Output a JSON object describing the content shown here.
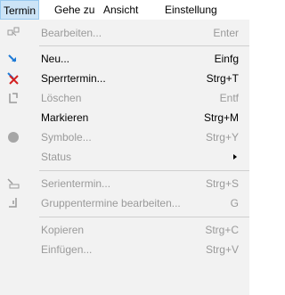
{
  "menubar": {
    "items": [
      {
        "label": "Termin",
        "active": true
      },
      {
        "label": "Gehe zu"
      },
      {
        "label": "Ansicht"
      },
      {
        "label": "Einstellung"
      }
    ]
  },
  "menu": {
    "items": [
      {
        "label": "Bearbeiten...",
        "shortcut": "Enter",
        "enabled": false,
        "icon": "edit-appointment-icon"
      },
      {
        "label": "Neu...",
        "shortcut": "Einfg",
        "enabled": true,
        "icon": "new-appointment-icon"
      },
      {
        "label": "Sperrtermin...",
        "shortcut": "Strg+T",
        "enabled": true,
        "icon": "block-appointment-icon"
      },
      {
        "label": "Löschen",
        "shortcut": "Entf",
        "enabled": false,
        "icon": "delete-icon"
      },
      {
        "label": "Markieren",
        "shortcut": "Strg+M",
        "enabled": true,
        "icon": ""
      },
      {
        "label": "Symbole...",
        "shortcut": "Strg+Y",
        "enabled": false,
        "icon": "symbol-circle-icon"
      },
      {
        "label": "Status",
        "shortcut": "",
        "enabled": false,
        "submenu": true,
        "icon": ""
      },
      {
        "label": "Serientermin...",
        "shortcut": "Strg+S",
        "enabled": false,
        "icon": "series-appointment-icon"
      },
      {
        "label": "Gruppentermine bearbeiten...",
        "shortcut": "G",
        "enabled": false,
        "icon": "group-appointment-icon"
      },
      {
        "label": "Kopieren",
        "shortcut": "Strg+C",
        "enabled": false,
        "icon": ""
      },
      {
        "label": "Einfügen...",
        "shortcut": "Strg+V",
        "enabled": false,
        "icon": ""
      }
    ]
  },
  "colors": {
    "menu_bg": "#f2f2f2",
    "disabled_text": "#9a9a9a",
    "active_menubar_bg": "#cce4f7",
    "blue_arrow": "#1f7bd6",
    "red_x": "#d32020"
  }
}
